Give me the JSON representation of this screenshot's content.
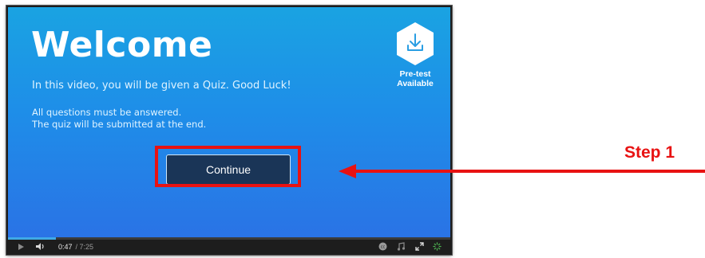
{
  "video": {
    "title": "Welcome",
    "intro": "In this video, you will be given a Quiz. Good Luck!",
    "rule_1": "All questions must be answered.",
    "rule_2": "The quiz will be submitted at the end.",
    "pretest_line1": "Pre-test",
    "pretest_line2": "Available",
    "continue_label": "Continue"
  },
  "player": {
    "current_time": "0:47",
    "total_time": "/ 7:25",
    "progress_fraction": 0.108,
    "accent": "#3fa9e6"
  },
  "annotation": {
    "step_label": "Step 1",
    "color": "#e81212"
  },
  "icons": [
    "download-icon",
    "play-icon",
    "volume-icon",
    "captions-icon",
    "music-icon",
    "fullscreen-icon",
    "loading-icon"
  ]
}
